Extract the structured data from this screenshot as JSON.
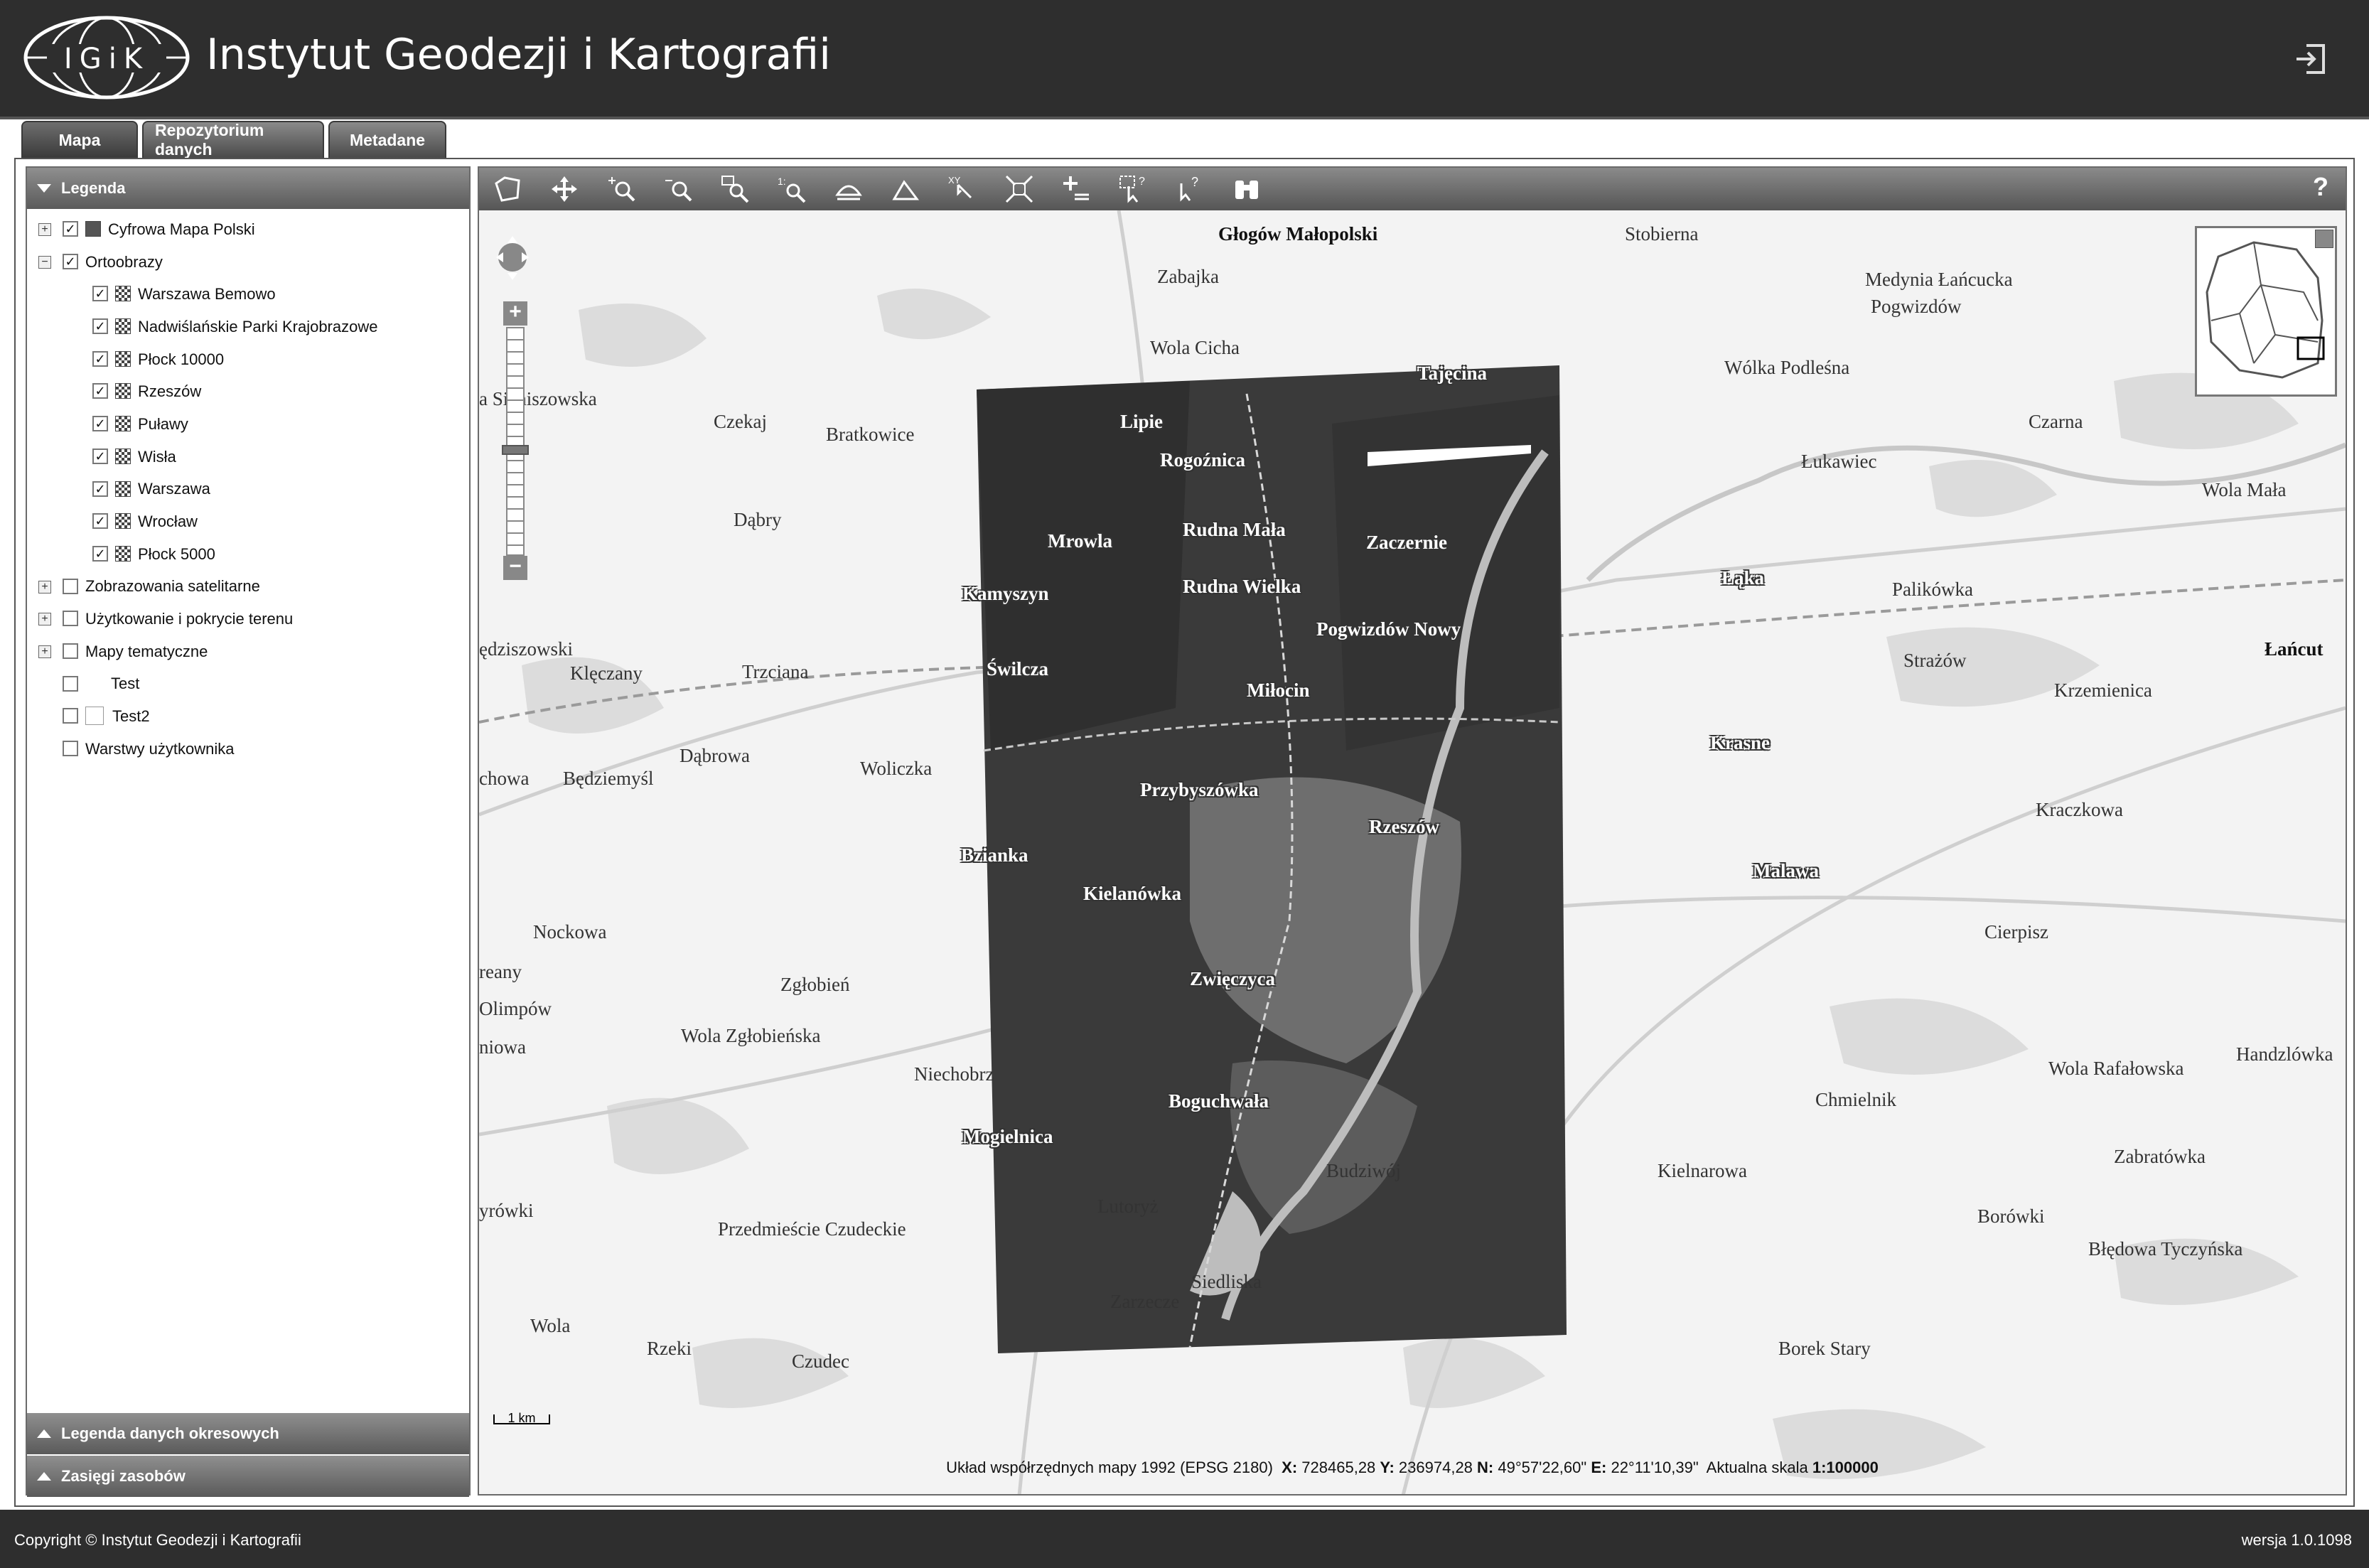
{
  "header": {
    "logo_text": "IGiK",
    "title": "Instytut Geodezji i Kartografii",
    "logout_icon": "logout-icon"
  },
  "tabs": [
    {
      "label": "Mapa",
      "active": true
    },
    {
      "label": "Repozytorium danych",
      "active": false
    },
    {
      "label": "Metadane",
      "active": false
    }
  ],
  "legend": {
    "title": "Legenda",
    "items": [
      {
        "label": "Cyfrowa Mapa Polski",
        "expander": "+",
        "checked": true,
        "swatch": "solid",
        "level": 0
      },
      {
        "label": "Ortoobrazy",
        "expander": "−",
        "checked": true,
        "swatch": "none",
        "level": 0
      },
      {
        "label": "Warszawa Bemowo",
        "checked": true,
        "swatch": "checker",
        "level": 1
      },
      {
        "label": "Nadwiślańskie Parki Krajobrazowe",
        "checked": true,
        "swatch": "checker",
        "level": 1
      },
      {
        "label": "Płock 10000",
        "checked": true,
        "swatch": "checker",
        "level": 1
      },
      {
        "label": "Rzeszów",
        "checked": true,
        "swatch": "checker",
        "level": 1
      },
      {
        "label": "Puławy",
        "checked": true,
        "swatch": "checker",
        "level": 1
      },
      {
        "label": "Wisła",
        "checked": true,
        "swatch": "checker",
        "level": 1
      },
      {
        "label": "Warszawa",
        "checked": true,
        "swatch": "checker",
        "level": 1
      },
      {
        "label": "Wrocław",
        "checked": true,
        "swatch": "checker",
        "level": 1
      },
      {
        "label": "Płock 5000",
        "checked": true,
        "swatch": "checker",
        "level": 1
      },
      {
        "label": "Zobrazowania satelitarne",
        "expander": "+",
        "checked": false,
        "swatch": "none",
        "level": 0
      },
      {
        "label": "Użytkowanie i pokrycie terenu",
        "expander": "+",
        "checked": false,
        "swatch": "none",
        "level": 0
      },
      {
        "label": "Mapy tematyczne",
        "expander": "+",
        "checked": false,
        "swatch": "none",
        "level": 0
      },
      {
        "label": "Test",
        "checked": false,
        "swatch": "none",
        "level": 0,
        "indent": true
      },
      {
        "label": "Test2",
        "checked": false,
        "swatch": "empty",
        "level": 0
      },
      {
        "label": "Warstwy użytkownika",
        "checked": false,
        "swatch": "none",
        "level": 0
      }
    ]
  },
  "panels": {
    "periodic_legend": "Legenda danych okresowych",
    "resource_extents": "Zasięgi zasobów"
  },
  "toolbar": {
    "tools": [
      "polygon-select-icon",
      "pan-icon",
      "zoom-in-icon",
      "zoom-out-icon",
      "zoom-box-icon",
      "zoom-1-1-icon",
      "measure-area-icon",
      "measure-distance-icon",
      "xy-coordinates-icon",
      "full-extent-icon",
      "add-layer-icon",
      "identify-icon",
      "query-icon",
      "binoculars-icon"
    ],
    "help_label": "?"
  },
  "map": {
    "places": [
      {
        "name": "Głogów Małopolski",
        "style": "bold"
      },
      {
        "name": "Stobierna",
        "style": ""
      },
      {
        "name": "Zabajka",
        "style": ""
      },
      {
        "name": "Medynia Łańcucka",
        "style": ""
      },
      {
        "name": "Pogwizdów",
        "style": ""
      },
      {
        "name": "Wola Cicha",
        "style": ""
      },
      {
        "name": "Tajęcina",
        "style": "onortho"
      },
      {
        "name": "Wólka Podleśna",
        "style": ""
      },
      {
        "name": "a Sieniszowska",
        "style": ""
      },
      {
        "name": "Czekaj",
        "style": ""
      },
      {
        "name": "Lipie",
        "style": "onortho"
      },
      {
        "name": "Czarna",
        "style": ""
      },
      {
        "name": "Bratkowice",
        "style": ""
      },
      {
        "name": "Rogoźnica",
        "style": "onortho"
      },
      {
        "name": "Łukawiec",
        "style": ""
      },
      {
        "name": "Wola Mała",
        "style": ""
      },
      {
        "name": "Dąbry",
        "style": ""
      },
      {
        "name": "Rudna Mała",
        "style": "onortho"
      },
      {
        "name": "Mrowla",
        "style": "onortho"
      },
      {
        "name": "Zaczernie",
        "style": "onortho"
      },
      {
        "name": "Łąka",
        "style": "onortho"
      },
      {
        "name": "Kamyszyn",
        "style": "onortho"
      },
      {
        "name": "Rudna Wielka",
        "style": "onortho"
      },
      {
        "name": "Palikówka",
        "style": ""
      },
      {
        "name": "Pogwizdów Nowy",
        "style": "onortho"
      },
      {
        "name": "ędziszowski",
        "style": ""
      },
      {
        "name": "Strażów",
        "style": ""
      },
      {
        "name": "Łańcut",
        "style": "bold"
      },
      {
        "name": "Klęczany",
        "style": ""
      },
      {
        "name": "Trzciana",
        "style": ""
      },
      {
        "name": "Świlcza",
        "style": "onortho"
      },
      {
        "name": "Miłocin",
        "style": "onortho"
      },
      {
        "name": "Krzemienica",
        "style": ""
      },
      {
        "name": "Dąbrowa",
        "style": ""
      },
      {
        "name": "Krasne",
        "style": "onortho"
      },
      {
        "name": "chowa",
        "style": ""
      },
      {
        "name": "Będziemyśl",
        "style": ""
      },
      {
        "name": "Woliczka",
        "style": ""
      },
      {
        "name": "Przybyszówka",
        "style": "onortho"
      },
      {
        "name": "Kraczkowa",
        "style": ""
      },
      {
        "name": "Rzeszów",
        "style": "onortho"
      },
      {
        "name": "Bzianka",
        "style": "onortho"
      },
      {
        "name": "Malawa",
        "style": "onortho"
      },
      {
        "name": "Kielanówka",
        "style": "onortho"
      },
      {
        "name": "Nockowa",
        "style": ""
      },
      {
        "name": "Cierpisz",
        "style": ""
      },
      {
        "name": "reany",
        "style": ""
      },
      {
        "name": "Zgłobień",
        "style": ""
      },
      {
        "name": "Zwięczyca",
        "style": "onortho"
      },
      {
        "name": "Olimpów",
        "style": ""
      },
      {
        "name": "Wola Zgłobieńska",
        "style": ""
      },
      {
        "name": "niowa",
        "style": ""
      },
      {
        "name": "Handzlówka",
        "style": ""
      },
      {
        "name": "Niechobrz",
        "style": ""
      },
      {
        "name": "Wola Rafałowska",
        "style": ""
      },
      {
        "name": "Boguchwała",
        "style": "onortho"
      },
      {
        "name": "Chmielnik",
        "style": ""
      },
      {
        "name": "Mogielnica",
        "style": "onortho"
      },
      {
        "name": "Zabratówka",
        "style": ""
      },
      {
        "name": "Budziwój",
        "style": ""
      },
      {
        "name": "Kielnarowa",
        "style": ""
      },
      {
        "name": "Lutoryż",
        "style": ""
      },
      {
        "name": "yrówki",
        "style": ""
      },
      {
        "name": "Borówki",
        "style": ""
      },
      {
        "name": "Przedmieście Czudeckie",
        "style": ""
      },
      {
        "name": "Błędowa Tyczyńska",
        "style": ""
      },
      {
        "name": "Siedliska",
        "style": ""
      },
      {
        "name": "Zarzecze",
        "style": ""
      },
      {
        "name": "Wola",
        "style": ""
      },
      {
        "name": "Rzeki",
        "style": ""
      },
      {
        "name": "Borek Stary",
        "style": ""
      },
      {
        "name": "Czudec",
        "style": ""
      }
    ],
    "scale_label": "1 km",
    "status": {
      "prefix": "Układ współrzędnych mapy 1992 (EPSG 2180)",
      "x_label": "X:",
      "x_value": "728465,28",
      "y_label": "Y:",
      "y_value": "236974,28",
      "n_label": "N:",
      "n_value": "49°57'22,60\"",
      "e_label": "E:",
      "e_value": "22°11'10,39\"",
      "scale_label": "Aktualna skala",
      "scale_value": "1:100000"
    }
  },
  "footer": {
    "copyright": "Copyright © Instytut Geodezji i Kartografii",
    "version": "wersja 1.0.1098"
  }
}
